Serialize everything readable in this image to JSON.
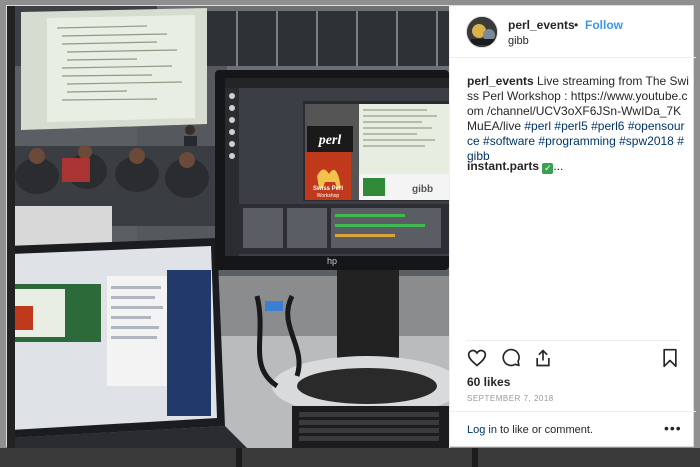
{
  "post": {
    "username": "perl_events",
    "separator": "•",
    "follow_label": "Follow",
    "location": "gibb",
    "caption": {
      "author": "perl_events",
      "text": "Live streaming from The Swiss Perl Workshop : https://www.youtube.com /channel/UCV3oXF6JSn-WwIDa_7KMuEA/live",
      "hashtags": [
        "#perl",
        "#perl5",
        "#perl6",
        "#opensource",
        "#software",
        "#programming",
        "#spw2018",
        "#gibb"
      ]
    },
    "comment": {
      "author": "instant.parts",
      "text": "..."
    },
    "likes": "60 likes",
    "date": "SEPTEMBER 7, 2018",
    "login_link": "Log in",
    "login_text": "to like or comment.",
    "more_label": "•••"
  },
  "photo": {
    "monitor_brand": "hp",
    "slide_logo": "perl",
    "badge_line1": "Swiss Perl",
    "badge_line2": "Workshop",
    "sponsor": "gibb"
  },
  "colors": {
    "accent": "#3897f0",
    "tag": "#003569",
    "text": "#262626",
    "muted": "#999999"
  },
  "icons": [
    "heart-icon",
    "comment-icon",
    "share-icon",
    "bookmark-icon",
    "checkmark-icon",
    "more-icon"
  ]
}
